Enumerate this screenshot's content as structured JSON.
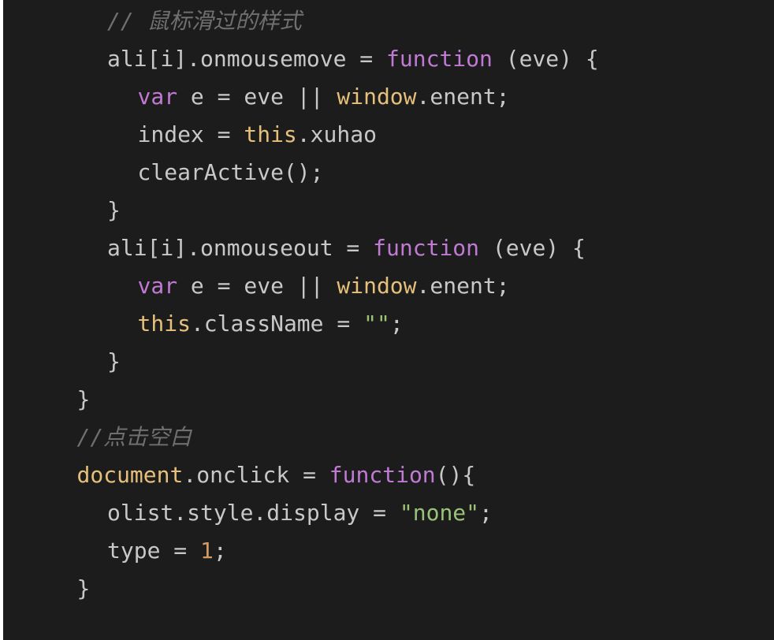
{
  "editor": {
    "lines": [
      {
        "indent": 2,
        "tokens": [
          {
            "t": "// 鼠标滑过的样式",
            "c": "comment"
          }
        ]
      },
      {
        "indent": 2,
        "tokens": [
          {
            "t": "ali[i].onmousemove = ",
            "c": "plain"
          },
          {
            "t": "function",
            "c": "kw"
          },
          {
            "t": " (eve) {",
            "c": "plain"
          }
        ]
      },
      {
        "indent": 3,
        "tokens": [
          {
            "t": "var",
            "c": "kw"
          },
          {
            "t": " e = eve || ",
            "c": "plain"
          },
          {
            "t": "window",
            "c": "obj"
          },
          {
            "t": ".enent;",
            "c": "plain"
          }
        ]
      },
      {
        "indent": 3,
        "tokens": [
          {
            "t": "index = ",
            "c": "plain"
          },
          {
            "t": "this",
            "c": "obj"
          },
          {
            "t": ".xuhao",
            "c": "plain"
          }
        ]
      },
      {
        "indent": 3,
        "tokens": [
          {
            "t": "clearActive();",
            "c": "plain"
          }
        ]
      },
      {
        "indent": 2,
        "tokens": [
          {
            "t": "}",
            "c": "plain"
          }
        ]
      },
      {
        "indent": 2,
        "tokens": [
          {
            "t": "ali[i].onmouseout = ",
            "c": "plain"
          },
          {
            "t": "function",
            "c": "kw"
          },
          {
            "t": " (eve) {",
            "c": "plain"
          }
        ]
      },
      {
        "indent": 3,
        "tokens": [
          {
            "t": "var",
            "c": "kw"
          },
          {
            "t": " e = eve || ",
            "c": "plain"
          },
          {
            "t": "window",
            "c": "obj"
          },
          {
            "t": ".enent;",
            "c": "plain"
          }
        ]
      },
      {
        "indent": 3,
        "tokens": [
          {
            "t": "this",
            "c": "obj"
          },
          {
            "t": ".className = ",
            "c": "plain"
          },
          {
            "t": "\"\"",
            "c": "str"
          },
          {
            "t": ";",
            "c": "plain"
          }
        ]
      },
      {
        "indent": 2,
        "tokens": [
          {
            "t": "}",
            "c": "plain"
          }
        ]
      },
      {
        "indent": 1,
        "tokens": [
          {
            "t": "}",
            "c": "plain"
          }
        ]
      },
      {
        "indent": 1,
        "tokens": [
          {
            "t": "//点击空白",
            "c": "comment"
          }
        ]
      },
      {
        "indent": 1,
        "tokens": [
          {
            "t": "document",
            "c": "obj"
          },
          {
            "t": ".onclick = ",
            "c": "plain"
          },
          {
            "t": "function",
            "c": "kw"
          },
          {
            "t": "(){",
            "c": "plain"
          }
        ]
      },
      {
        "indent": 2,
        "tokens": [
          {
            "t": "olist.style.display = ",
            "c": "plain"
          },
          {
            "t": "\"none\"",
            "c": "str"
          },
          {
            "t": ";",
            "c": "plain"
          }
        ]
      },
      {
        "indent": 2,
        "tokens": [
          {
            "t": "type = ",
            "c": "plain"
          },
          {
            "t": "1",
            "c": "num"
          },
          {
            "t": ";",
            "c": "plain"
          }
        ]
      },
      {
        "indent": 1,
        "tokens": [
          {
            "t": "}",
            "c": "plain"
          }
        ]
      }
    ]
  },
  "colors": {
    "background": "#1c1c1c",
    "comment": "#6f6f6f",
    "keyword": "#c07ad4",
    "object": "#e6c07b",
    "string": "#98c379",
    "number": "#d19a66",
    "plain": "#c8c8c8"
  }
}
